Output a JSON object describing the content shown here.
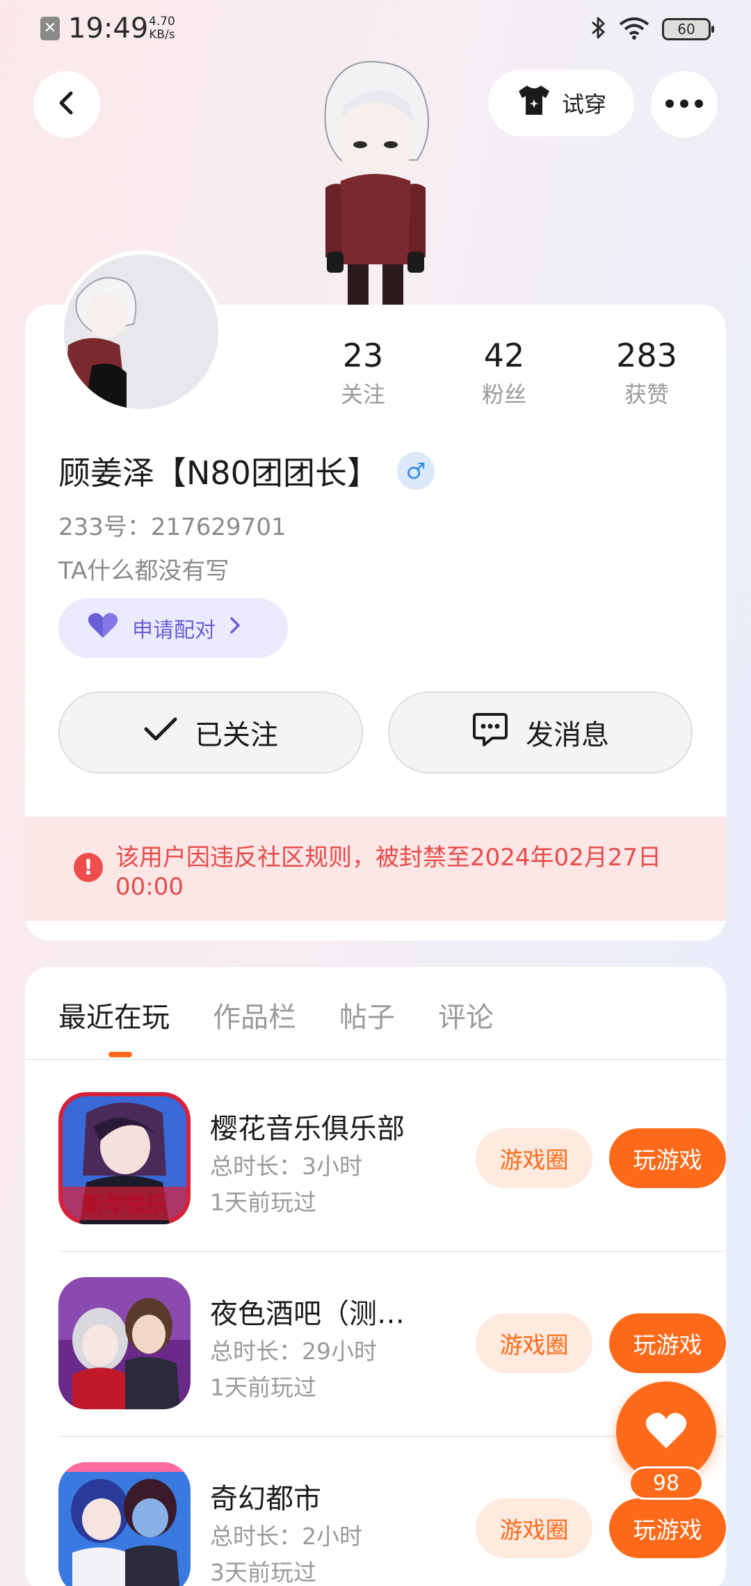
{
  "status_bar": {
    "time": "19:49",
    "speed_value": "4.70",
    "speed_unit": "KB/s",
    "battery": "60",
    "icons": [
      "notification-x-icon",
      "bluetooth-icon",
      "wifi-icon",
      "battery-icon"
    ]
  },
  "header": {
    "back_icon": "back-arrow-icon",
    "try_on_label": "试穿",
    "try_on_icon": "tshirt-icon",
    "more_icon": "more-dots-icon"
  },
  "profile": {
    "stats": [
      {
        "value": "23",
        "label": "关注"
      },
      {
        "value": "42",
        "label": "粉丝"
      },
      {
        "value": "283",
        "label": "获赞"
      }
    ],
    "username": "顾姜泽【N80团团长】",
    "gender_icon": "male-icon",
    "gender_symbol": "♂",
    "uid": "233号：217629701",
    "bio": "TA什么都没有写",
    "pair_label": "申请配对",
    "follow_label": "已关注",
    "message_label": "发消息",
    "ban_notice": "该用户因违反社区规则，被封禁至2024年02月27日 00:00"
  },
  "tabs": [
    {
      "label": "最近在玩",
      "active": true
    },
    {
      "label": "作品栏",
      "active": false
    },
    {
      "label": "帖子",
      "active": false
    },
    {
      "label": "评论",
      "active": false
    }
  ],
  "games": [
    {
      "name": "樱花音乐俱乐部",
      "duration": "总时长：3小时",
      "last_played": "1天前玩过",
      "icon_caption": "新年快乐",
      "circle_label": "游戏圈",
      "play_label": "玩游戏"
    },
    {
      "name": "夜色酒吧（测…",
      "duration": "总时长：29小时",
      "last_played": "1天前玩过",
      "circle_label": "游戏圈",
      "play_label": "玩游戏"
    },
    {
      "name": "奇幻都市",
      "duration": "总时长：2小时",
      "last_played": "3天前玩过",
      "circle_label": "游戏圈",
      "play_label": "玩游戏"
    }
  ],
  "fab": {
    "icon": "heart-icon",
    "count": "98"
  },
  "colors": {
    "accent": "#ff6a1a",
    "ban_text": "#e84a4a",
    "pair_text": "#6a5ed6"
  }
}
